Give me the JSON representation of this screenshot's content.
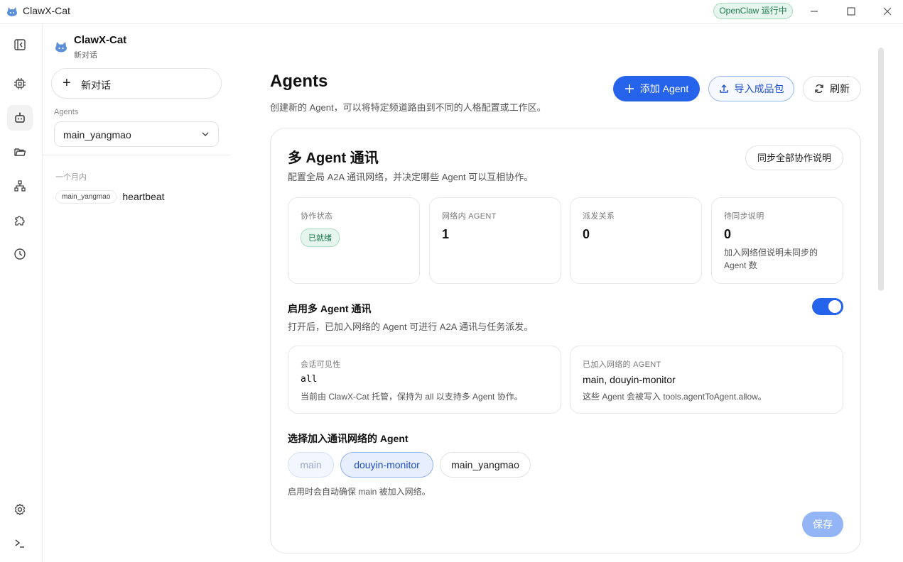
{
  "window": {
    "app_title": "ClawX-Cat",
    "status_label": "OpenClaw 运行中"
  },
  "sidebar": {
    "workspace_name": "ClawX-Cat",
    "workspace_subtitle": "新对话",
    "new_chat_label": "新对话",
    "agents_label": "Agents",
    "selected_agent": "main_yangmao",
    "group_label": "一个月内",
    "sessions": [
      {
        "tag": "main_yangmao",
        "title": "heartbeat"
      }
    ]
  },
  "page": {
    "title": "Agents",
    "subtitle": "创建新的 Agent，可以将特定频道路由到不同的人格配置或工作区。",
    "add_button": "添加 Agent",
    "import_button": "导入成品包",
    "refresh_button": "刷新"
  },
  "a2a": {
    "title": "多 Agent 通讯",
    "subtitle": "配置全局 A2A 通讯网络，并决定哪些 Agent 可以互相协作。",
    "sync_button": "同步全部协作说明",
    "stats": {
      "status": {
        "label": "协作状态",
        "badge": "已就绪"
      },
      "agents_in_network": {
        "label": "网络内 AGENT",
        "value": "1"
      },
      "dispatch_relations": {
        "label": "派发关系",
        "value": "0"
      },
      "pending_sync": {
        "label": "待同步说明",
        "value": "0",
        "desc": "加入网络但说明未同步的 Agent 数"
      }
    },
    "toggle": {
      "title": "启用多 Agent 通讯",
      "subtitle": "打开后，已加入网络的 Agent 可进行 A2A 通讯与任务派发。",
      "enabled": true
    },
    "visibility": {
      "label": "会话可见性",
      "value": "all",
      "desc": "当前由 ClawX-Cat 托管，保持为 all 以支持多 Agent 协作。"
    },
    "joined": {
      "label": "已加入网络的 AGENT",
      "value": "main, douyin-monitor",
      "desc": "这些 Agent 会被写入 tools.agentToAgent.allow。"
    },
    "select_title": "选择加入通讯网络的 Agent",
    "chips": [
      {
        "label": "main",
        "state": "locked"
      },
      {
        "label": "douyin-monitor",
        "state": "selected"
      },
      {
        "label": "main_yangmao",
        "state": "unselected"
      }
    ],
    "select_hint": "启用时会自动确保 main 被加入网络。",
    "save_button": "保存"
  },
  "colors": {
    "accent": "#2563eb",
    "success": "#1c7a4c"
  }
}
